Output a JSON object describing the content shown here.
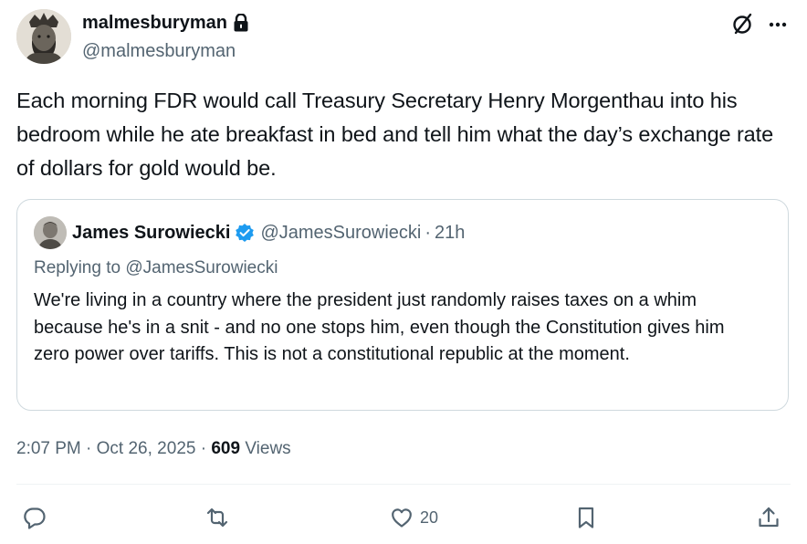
{
  "author": {
    "display_name": "malmesburyman",
    "handle": "@malmesburyman",
    "locked": true
  },
  "tweet": {
    "text": "Each morning FDR would call Treasury Secretary Henry Morgenthau into his bedroom while he ate breakfast in bed and tell him what the day’s exchange rate of dollars for gold would be."
  },
  "quoted": {
    "display_name": "James Surowiecki",
    "handle": "@JamesSurowiecki",
    "separator": "·",
    "time": "21h",
    "replying_to": "Replying to @JamesSurowiecki",
    "text": "We're living in a country where the president just randomly raises taxes on a whim because he's in a snit - and no one stops him, even though the Constitution gives him zero power over tariffs. This is not a constitutional republic at the moment.",
    "verified_color": "#1d9bf0"
  },
  "meta": {
    "time": "2:07 PM",
    "separator": "·",
    "date": "Oct 26, 2025",
    "views_count": "609",
    "views_label": "Views"
  },
  "actions": {
    "likes": "20"
  },
  "icons": {
    "lock": "lock-icon",
    "grok": "grok-icon",
    "more": "more-icon",
    "verified": "verified-badge-icon",
    "reply": "reply-icon",
    "repost": "repost-icon",
    "like": "heart-icon",
    "bookmark": "bookmark-icon",
    "share": "share-icon"
  },
  "colors": {
    "text": "#0f1419",
    "secondary": "#536471",
    "border": "#cfd9de",
    "accent": "#1d9bf0"
  }
}
